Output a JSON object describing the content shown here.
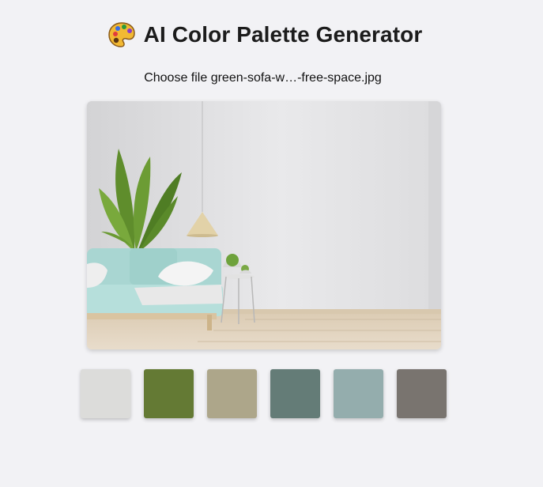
{
  "header": {
    "icon": "artist-palette-icon",
    "title": "AI Color Palette Generator"
  },
  "file_input": {
    "button_label": "Choose file",
    "file_name": "green-sofa-w…-free-space.jpg"
  },
  "preview": {
    "description_icon": "room-photo"
  },
  "palette": {
    "swatches": [
      {
        "color": "#dcdcda"
      },
      {
        "color": "#647a34"
      },
      {
        "color": "#ada68a"
      },
      {
        "color": "#647c77"
      },
      {
        "color": "#94adad"
      },
      {
        "color": "#79746f"
      }
    ]
  }
}
